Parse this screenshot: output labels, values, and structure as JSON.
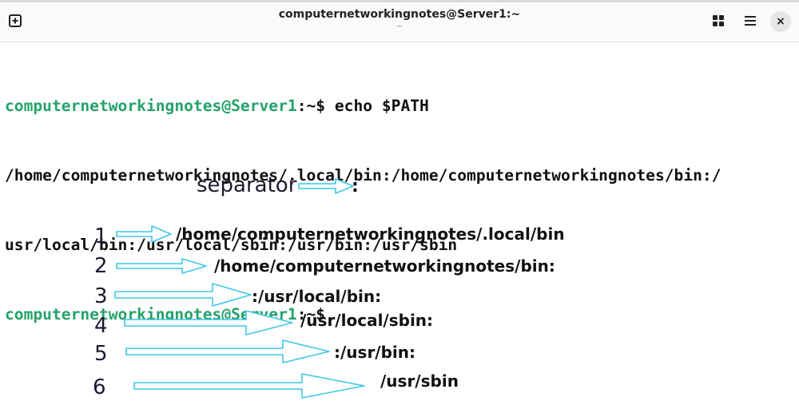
{
  "window": {
    "title": "computernetworkingnotes@Server1:~",
    "subtitle": "~",
    "close_symbol": "×"
  },
  "terminal": {
    "prompt_user_host": "computernetworkingnotes@Server1",
    "prompt_path": ":~$",
    "command": " echo $PATH",
    "output_line_1": "/home/computernetworkingnotes/.local/bin:/home/computernetworkingnotes/bin:/",
    "output_line_2": "usr/local/bin:/usr/local/sbin:/usr/bin:/usr/sbin"
  },
  "annotation": {
    "separator_label": "separator",
    "separator_char": ":",
    "entries": [
      {
        "num": "1",
        "path": "/home/computernetworkingnotes/.local/bin"
      },
      {
        "num": "2",
        "path": "/home/computernetworkingnotes/bin:"
      },
      {
        "num": "3",
        "path": ":/usr/local/bin:"
      },
      {
        "num": "4",
        "path": "/usr/local/sbin:"
      },
      {
        "num": "5",
        "path": ":/usr/bin:"
      },
      {
        "num": "6",
        "path": "/usr/sbin"
      }
    ],
    "arrow_color": "#3fc7e6"
  }
}
